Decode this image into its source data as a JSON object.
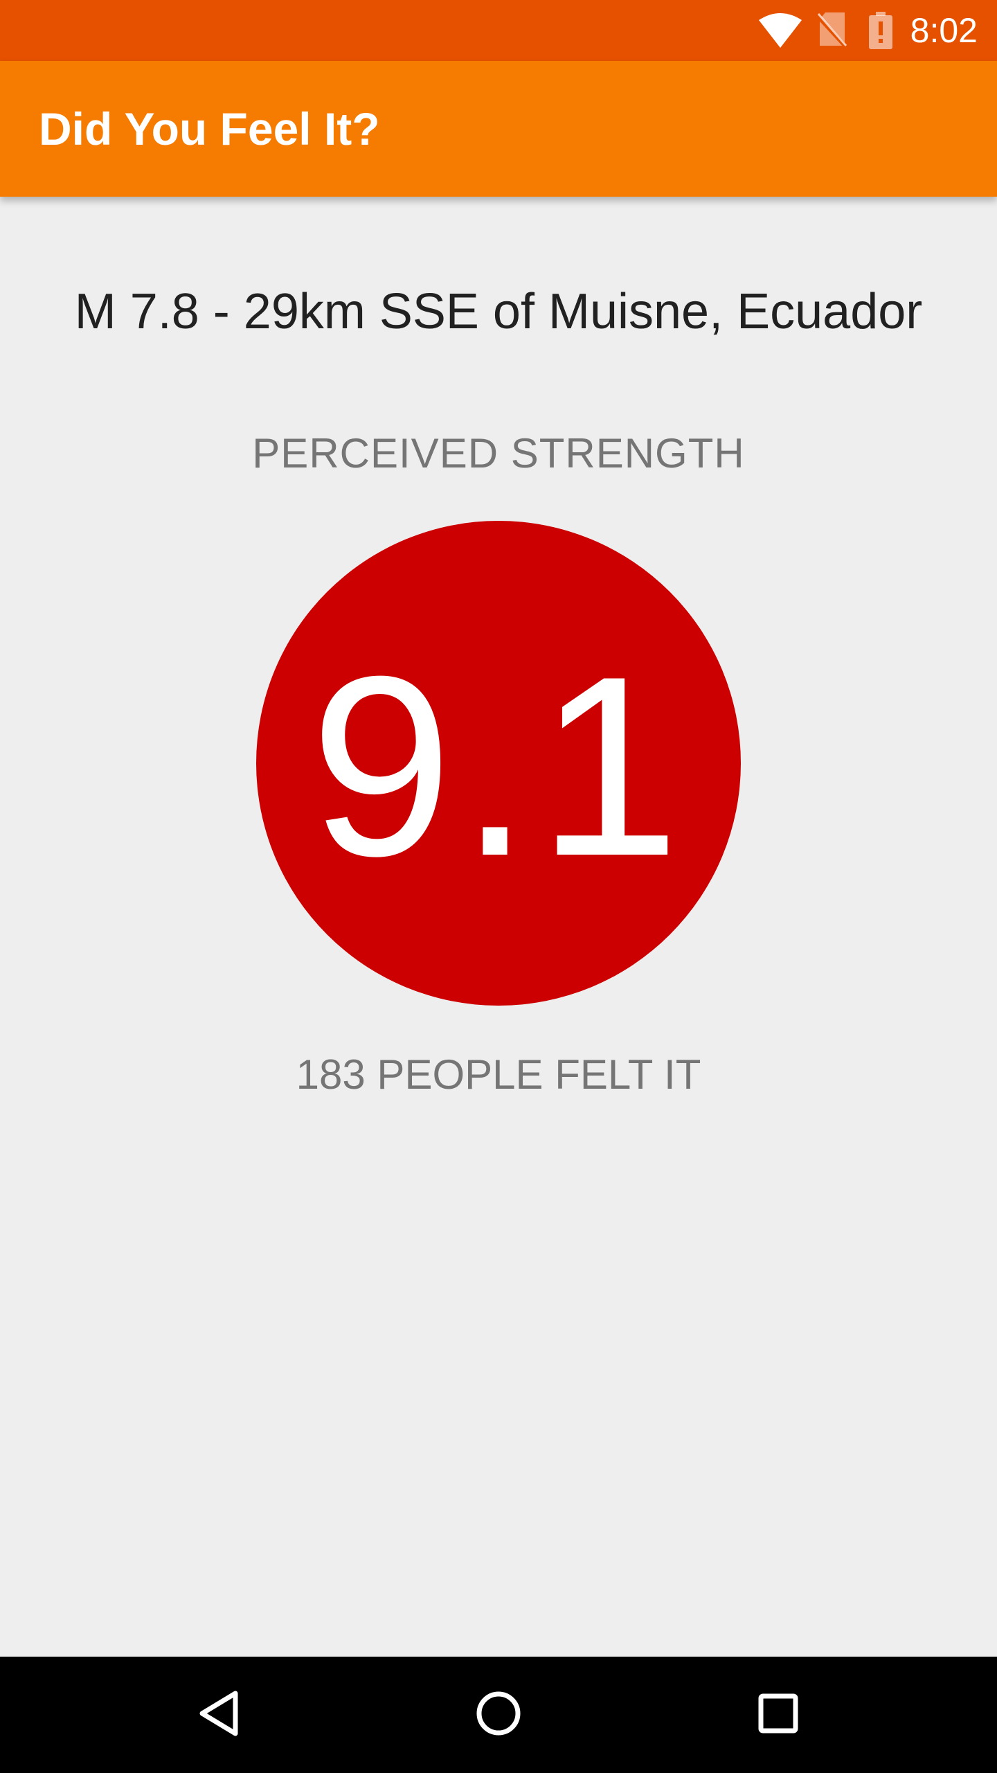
{
  "status_bar": {
    "time": "8:02",
    "icons": [
      "wifi-icon",
      "no-sim-icon",
      "battery-alert-icon"
    ],
    "background_color": "#e65100"
  },
  "app_bar": {
    "title": "Did You Feel It?",
    "background_color": "#f57c00"
  },
  "event": {
    "title": "M 7.8 - 29km SSE of Muisne, Ecuador",
    "strength_label": "PERCEIVED STRENGTH",
    "magnitude": "9.1",
    "magnitude_color": "#cc0000",
    "felt_count_text": "183 PEOPLE FELT IT"
  },
  "nav_bar": {
    "buttons": [
      "back-icon",
      "home-icon",
      "recents-icon"
    ]
  }
}
